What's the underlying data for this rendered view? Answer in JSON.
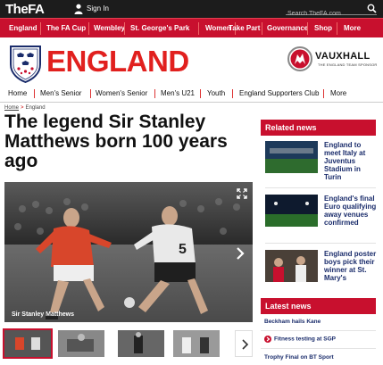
{
  "topbar": {
    "logo_the": "The",
    "logo_fa": "FA",
    "signin": "Sign In",
    "search_placeholder": "Search TheFA.com"
  },
  "main_nav": {
    "items": [
      "England",
      "The FA Cup",
      "Wembley",
      "St. George's Park",
      "Women",
      "Take Part",
      "Governance",
      "Shop",
      "More"
    ]
  },
  "header": {
    "title": "ENGLAND",
    "sponsor_name": "VAUXHALL",
    "sponsor_tag": "THE ENGLAND TEAM SPONSOR"
  },
  "section_nav": {
    "items": [
      "Home",
      "Men's Senior",
      "Women's Senior",
      "Men's U21",
      "Youth",
      "England Supporters Club",
      "More"
    ]
  },
  "breadcrumb": {
    "home": "Home",
    "current": "England"
  },
  "article": {
    "headline": "The legend Sir Stanley Matthews born 100 years ago",
    "hero_caption": "Sir Stanley Matthews"
  },
  "related": {
    "title": "Related news",
    "items": [
      {
        "text": "England to meet Italy at Juventus Stadium in Turin"
      },
      {
        "text": "England's final Euro qualifying away venues confirmed"
      },
      {
        "text": "England poster boys pick their winner at St. Mary's"
      }
    ]
  },
  "latest": {
    "title": "Latest news",
    "items": [
      {
        "text": "Beckham hails Kane",
        "icon": ""
      },
      {
        "text": "Fitness testing at SGP",
        "icon": "arrow-right-icon"
      },
      {
        "text": "Trophy Final on BT Sport",
        "icon": ""
      }
    ]
  },
  "colors": {
    "brand_red": "#c8102e",
    "link_navy": "#1a2c6b",
    "topbar": "#1c1c1c"
  }
}
